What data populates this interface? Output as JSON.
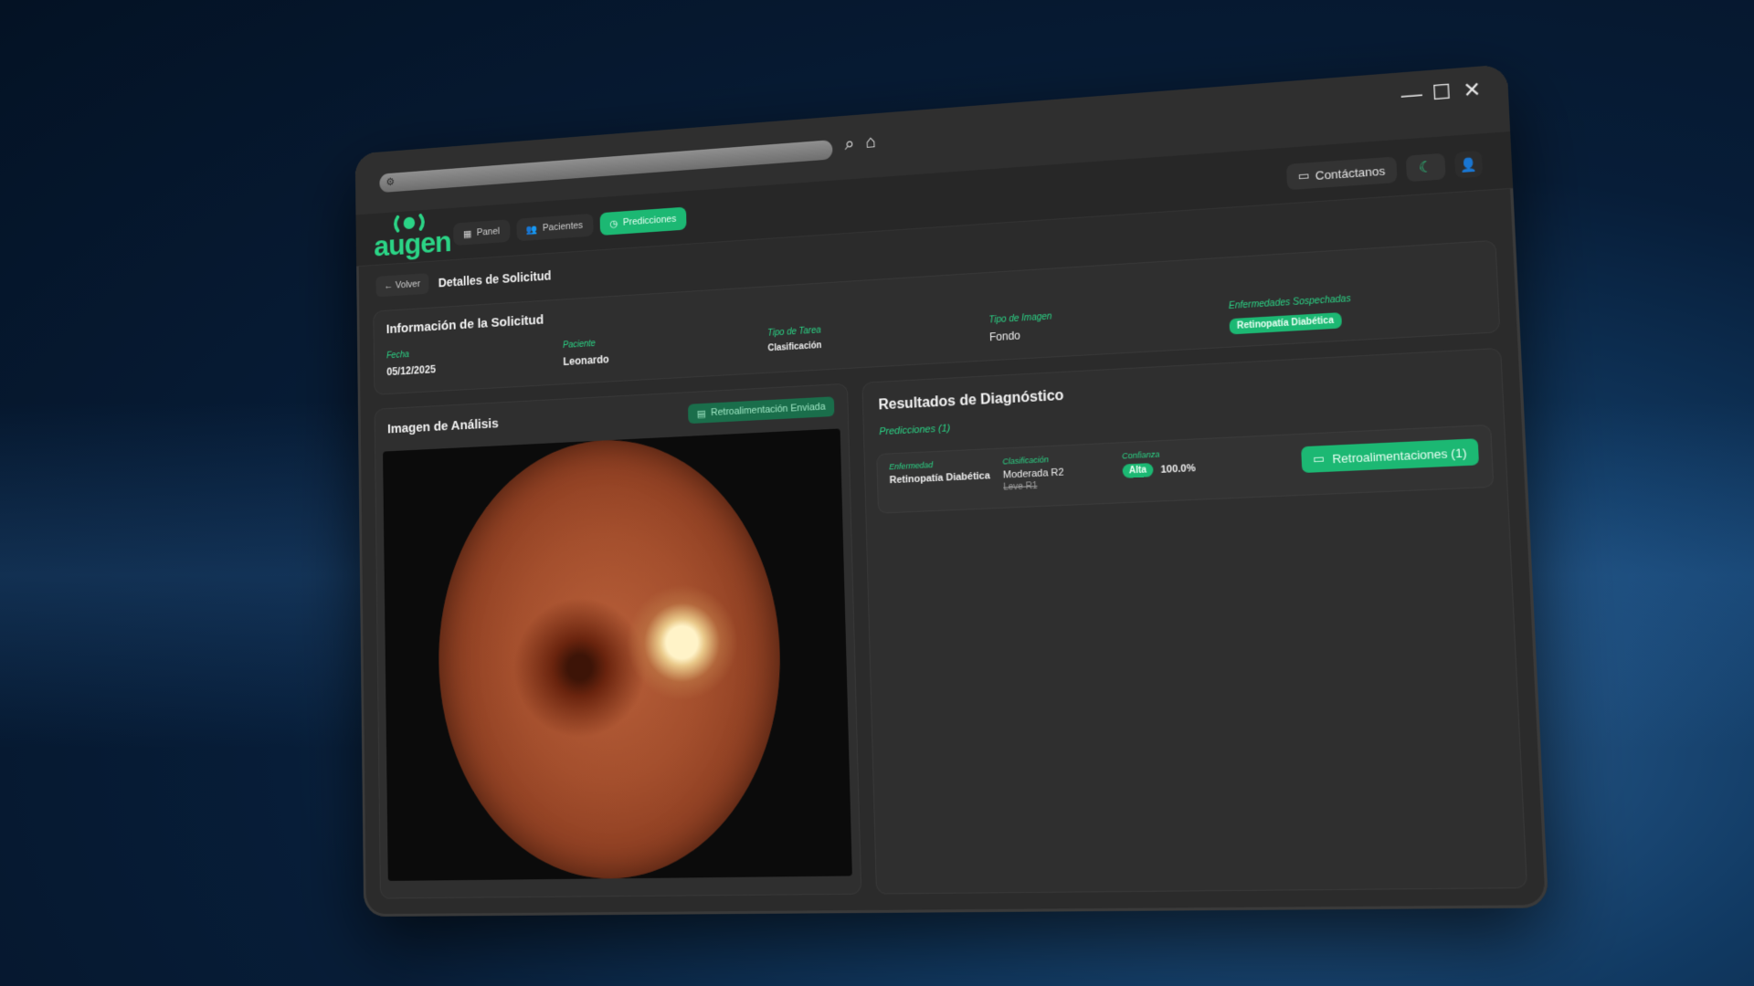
{
  "browser": {
    "url_icon": "sliders-icon",
    "search_icon": "search-icon",
    "home_icon": "home-icon",
    "controls": {
      "minimize": "—",
      "maximize": "☐",
      "close": "✕"
    }
  },
  "app": {
    "logo_text": "augen",
    "nav": [
      {
        "label": "Panel",
        "icon": "dashboard-icon",
        "active": false
      },
      {
        "label": "Pacientes",
        "icon": "users-icon",
        "active": false
      },
      {
        "label": "Predicciones",
        "icon": "clock-icon",
        "active": true
      }
    ],
    "contact_label": "Contáctanos",
    "theme_icon": "moon-icon",
    "user_icon": "user-icon",
    "accent": "#1cb873"
  },
  "breadcrumb": {
    "back_label": "← Volver",
    "title": "Detalles de Solicitud"
  },
  "info": {
    "title": "Información de la Solicitud",
    "fields": [
      {
        "label": "Fecha",
        "value": "05/12/2025"
      },
      {
        "label": "Paciente",
        "value": "Leonardo"
      },
      {
        "label": "Tipo de Tarea",
        "value": "Clasificación"
      },
      {
        "label": "Tipo de Imagen",
        "value": "Fondo"
      },
      {
        "label": "Enfermedades Sospechadas",
        "value": "Retinopatía Diabética"
      }
    ]
  },
  "image_panel": {
    "title": "Imagen de Análisis",
    "feedback_sent": "Retroalimentación Enviada"
  },
  "results": {
    "title": "Resultados de Diagnóstico",
    "subtitle": "Predicciones (1)",
    "prediction": {
      "disease_label": "Enfermedad",
      "disease": "Retinopatía Diabética",
      "class_label": "Clasificación",
      "class_value": "Moderada R2",
      "class_prev": "Leve R1",
      "conf_label": "Confianza",
      "conf_level": "Alta",
      "conf_value": "100.0%"
    },
    "feedback_button": "Retroalimentaciones (1)"
  }
}
